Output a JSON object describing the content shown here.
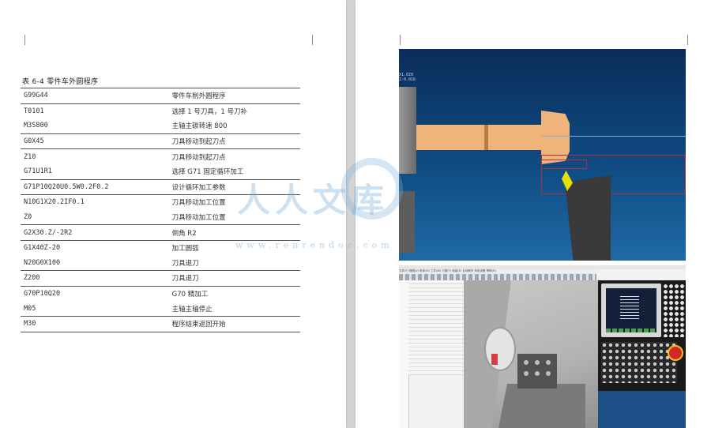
{
  "left_page": {
    "caption": "表 6-4 零件车外圆程序",
    "rows": [
      {
        "code": "G99G44",
        "comment": "零件车削外圆程序",
        "top_border": true
      },
      {
        "code": "T0101",
        "comment": "选择 1 号刀具，1 号刀补",
        "top_border": true
      },
      {
        "code": "M3S800",
        "comment": "主轴主碳转速 800",
        "top_border": false
      },
      {
        "code": "G0X45",
        "comment": "刀具移动到起刀点",
        "top_border": true
      },
      {
        "code": "Z10",
        "comment": "刀具移动到起刀点",
        "top_border": true
      },
      {
        "code": "G71U1R1",
        "comment": "选择 G71 固定循环加工",
        "top_border": false
      },
      {
        "code": "G71P10Q20U0.5W0.2F0.2",
        "comment": "设计循环加工参数",
        "top_border": true
      },
      {
        "code": "N10G1X20.2IF0.1",
        "comment": "刀具移动加工位置",
        "top_border": true
      },
      {
        "code": "Z0",
        "comment": "刀具移动加工位置",
        "top_border": false
      },
      {
        "code": "G2X30.Z/-2R2",
        "comment": "倒角 R2",
        "top_border": true
      },
      {
        "code": "G1X40Z-20",
        "comment": "加工圆弧",
        "top_border": true
      },
      {
        "code": "N20G0X100",
        "comment": "刀具退刀",
        "top_border": false
      },
      {
        "code": "Z200",
        "comment": "刀具退刀",
        "top_border": true
      },
      {
        "code": "G70P10Q20",
        "comment": "G70 精加工",
        "top_border": true
      },
      {
        "code": "M05",
        "comment": "主轴主轴停止",
        "top_border": false
      },
      {
        "code": "M30",
        "comment": "程序结束返回开始",
        "top_border": true
      }
    ]
  },
  "right_page": {
    "sim_readout": "X1.020\nZ-0.016",
    "software_menu": "文件(F)  视图(V)  机床(M)  工件(W)  刀具(T)  测量(E)  互动教学  系统设置  帮助(H)"
  },
  "watermark": {
    "text": "人人文库",
    "url": "www.renrendoc.com"
  },
  "colors": {
    "workpiece": "#f0b37a",
    "sim_bg": "#0f4b82",
    "tool_insert": "#e8e000",
    "watermark": "#78afdc"
  }
}
